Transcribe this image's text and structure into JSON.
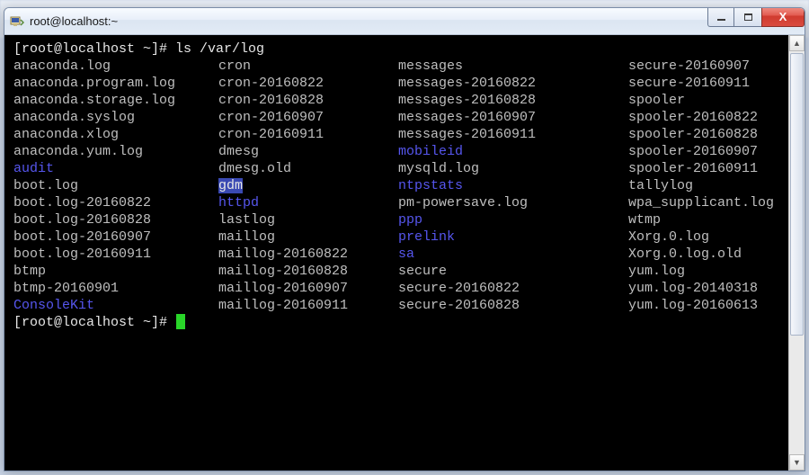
{
  "window": {
    "title": "root@localhost:~"
  },
  "terminal": {
    "prompt": "[root@localhost ~]# ",
    "command": "ls /var/log",
    "prompt2": "[root@localhost ~]# "
  },
  "listing": [
    {
      "c1": {
        "t": "anaconda.log",
        "k": "file"
      },
      "c2": {
        "t": "cron",
        "k": "file"
      },
      "c3": {
        "t": "messages",
        "k": "file"
      },
      "c4": {
        "t": "secure-20160907",
        "k": "file"
      }
    },
    {
      "c1": {
        "t": "anaconda.program.log",
        "k": "file"
      },
      "c2": {
        "t": "cron-20160822",
        "k": "file"
      },
      "c3": {
        "t": "messages-20160822",
        "k": "file"
      },
      "c4": {
        "t": "secure-20160911",
        "k": "file"
      }
    },
    {
      "c1": {
        "t": "anaconda.storage.log",
        "k": "file"
      },
      "c2": {
        "t": "cron-20160828",
        "k": "file"
      },
      "c3": {
        "t": "messages-20160828",
        "k": "file"
      },
      "c4": {
        "t": "spooler",
        "k": "file"
      }
    },
    {
      "c1": {
        "t": "anaconda.syslog",
        "k": "file"
      },
      "c2": {
        "t": "cron-20160907",
        "k": "file"
      },
      "c3": {
        "t": "messages-20160907",
        "k": "file"
      },
      "c4": {
        "t": "spooler-20160822",
        "k": "file"
      }
    },
    {
      "c1": {
        "t": "anaconda.xlog",
        "k": "file"
      },
      "c2": {
        "t": "cron-20160911",
        "k": "file"
      },
      "c3": {
        "t": "messages-20160911",
        "k": "file"
      },
      "c4": {
        "t": "spooler-20160828",
        "k": "file"
      }
    },
    {
      "c1": {
        "t": "anaconda.yum.log",
        "k": "file"
      },
      "c2": {
        "t": "dmesg",
        "k": "file"
      },
      "c3": {
        "t": "mobileid",
        "k": "dir"
      },
      "c4": {
        "t": "spooler-20160907",
        "k": "file"
      }
    },
    {
      "c1": {
        "t": "audit",
        "k": "dir"
      },
      "c2": {
        "t": "dmesg.old",
        "k": "file"
      },
      "c3": {
        "t": "mysqld.log",
        "k": "file"
      },
      "c4": {
        "t": "spooler-20160911",
        "k": "file"
      }
    },
    {
      "c1": {
        "t": "boot.log",
        "k": "file"
      },
      "c2": {
        "t": "gdm",
        "k": "dir-hl"
      },
      "c3": {
        "t": "ntpstats",
        "k": "dir"
      },
      "c4": {
        "t": "tallylog",
        "k": "file"
      }
    },
    {
      "c1": {
        "t": "boot.log-20160822",
        "k": "file"
      },
      "c2": {
        "t": "httpd",
        "k": "dir"
      },
      "c3": {
        "t": "pm-powersave.log",
        "k": "file"
      },
      "c4": {
        "t": "wpa_supplicant.log",
        "k": "file"
      }
    },
    {
      "c1": {
        "t": "boot.log-20160828",
        "k": "file"
      },
      "c2": {
        "t": "lastlog",
        "k": "file"
      },
      "c3": {
        "t": "ppp",
        "k": "dir"
      },
      "c4": {
        "t": "wtmp",
        "k": "file"
      }
    },
    {
      "c1": {
        "t": "boot.log-20160907",
        "k": "file"
      },
      "c2": {
        "t": "maillog",
        "k": "file"
      },
      "c3": {
        "t": "prelink",
        "k": "dir"
      },
      "c4": {
        "t": "Xorg.0.log",
        "k": "file"
      }
    },
    {
      "c1": {
        "t": "boot.log-20160911",
        "k": "file"
      },
      "c2": {
        "t": "maillog-20160822",
        "k": "file"
      },
      "c3": {
        "t": "sa",
        "k": "dir"
      },
      "c4": {
        "t": "Xorg.0.log.old",
        "k": "file"
      }
    },
    {
      "c1": {
        "t": "btmp",
        "k": "file"
      },
      "c2": {
        "t": "maillog-20160828",
        "k": "file"
      },
      "c3": {
        "t": "secure",
        "k": "file"
      },
      "c4": {
        "t": "yum.log",
        "k": "file"
      }
    },
    {
      "c1": {
        "t": "btmp-20160901",
        "k": "file"
      },
      "c2": {
        "t": "maillog-20160907",
        "k": "file"
      },
      "c3": {
        "t": "secure-20160822",
        "k": "file"
      },
      "c4": {
        "t": "yum.log-20140318",
        "k": "file"
      }
    },
    {
      "c1": {
        "t": "ConsoleKit",
        "k": "dir"
      },
      "c2": {
        "t": "maillog-20160911",
        "k": "file"
      },
      "c3": {
        "t": "secure-20160828",
        "k": "file"
      },
      "c4": {
        "t": "yum.log-20160613",
        "k": "file"
      }
    }
  ]
}
